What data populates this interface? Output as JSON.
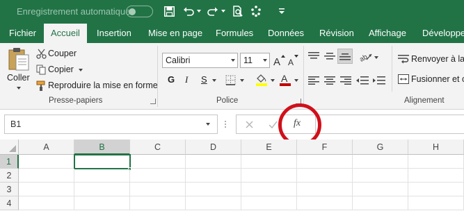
{
  "titlebar": {
    "autosave_label": "Enregistrement automatique",
    "autosave_state": "off",
    "icons": [
      "save-icon",
      "undo-icon",
      "redo-icon",
      "print-preview-icon",
      "touch-mode-icon",
      "customize-qat-icon"
    ]
  },
  "tabs": [
    "Fichier",
    "Accueil",
    "Insertion",
    "Mise en page",
    "Formules",
    "Données",
    "Révision",
    "Affichage",
    "Développeu"
  ],
  "active_tab": "Accueil",
  "clipboard": {
    "paste_label": "Coller",
    "cut_label": "Couper",
    "copy_label": "Copier",
    "format_painter_label": "Reproduire la mise en forme",
    "group_label": "Presse-papiers"
  },
  "font": {
    "name": "Calibri",
    "size": "11",
    "bold": "G",
    "italic": "I",
    "underline": "S",
    "group_label": "Police",
    "fill_color": "#ffff00",
    "font_color": "#c00000"
  },
  "alignment": {
    "wrap_label": "Renvoyer à la l",
    "merge_label": "Fusionner et ce",
    "group_label": "Alignement"
  },
  "formula_bar": {
    "name_box": "B1",
    "fx_label": "fx",
    "formula": ""
  },
  "grid": {
    "columns": [
      "A",
      "B",
      "C",
      "D",
      "E",
      "F",
      "G",
      "H"
    ],
    "rows": [
      "1",
      "2",
      "3",
      "4"
    ],
    "selected_cell": "B1"
  },
  "colors": {
    "brand": "#217346",
    "highlight_circle": "#d0101a"
  }
}
